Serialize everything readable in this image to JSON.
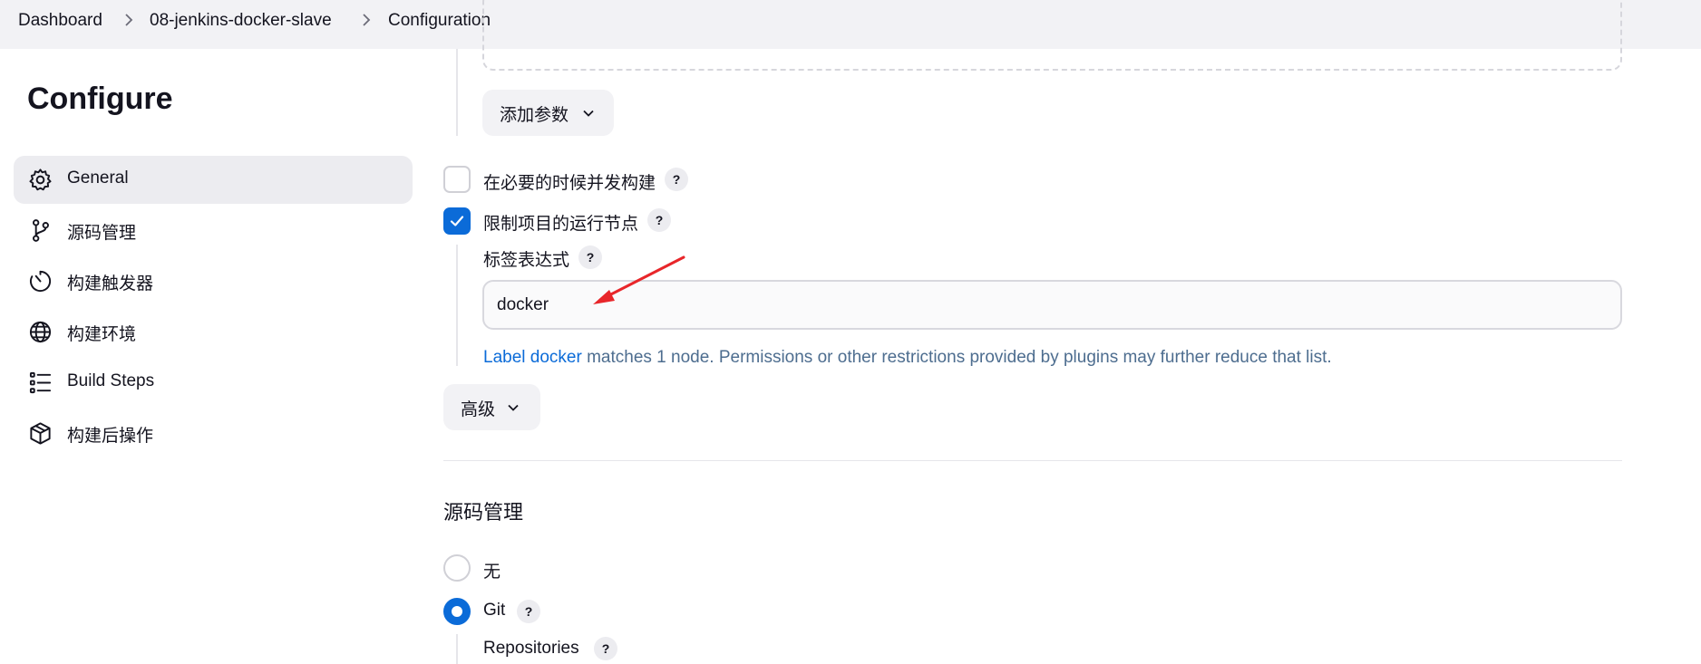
{
  "breadcrumb": [
    "Dashboard",
    "08-jenkins-docker-slave",
    "Configuration"
  ],
  "page_title": "Configure",
  "sidebar": {
    "items": [
      {
        "label": "General",
        "icon": "gear-icon",
        "active": true
      },
      {
        "label": "源码管理",
        "icon": "source-branch-icon",
        "active": false
      },
      {
        "label": "构建触发器",
        "icon": "timer-icon",
        "active": false
      },
      {
        "label": "构建环境",
        "icon": "globe-icon",
        "active": false
      },
      {
        "label": "Build Steps",
        "icon": "list-icon",
        "active": false
      },
      {
        "label": "构建后操作",
        "icon": "package-icon",
        "active": false
      }
    ]
  },
  "general": {
    "add_param_button": "添加参数",
    "concurrent_build": {
      "label": "在必要的时候并发构建",
      "checked": false
    },
    "restrict_node": {
      "label": "限制项目的运行节点",
      "checked": true
    },
    "label_expression": {
      "label": "标签表达式",
      "value": "docker"
    },
    "match_message": {
      "link": "Label docker",
      "text": " matches 1 node. Permissions or other restrictions provided by plugins may further reduce that list."
    },
    "advanced_button": "高级",
    "help": "?"
  },
  "scm": {
    "title": "源码管理",
    "options": [
      {
        "label": "无",
        "selected": false
      },
      {
        "label": "Git",
        "selected": true
      }
    ],
    "repositories_label": "Repositories"
  },
  "colors": {
    "accent": "#0b6bd8",
    "annotation_arrow": "#e8262a",
    "link_text": "#4d6d8f"
  }
}
